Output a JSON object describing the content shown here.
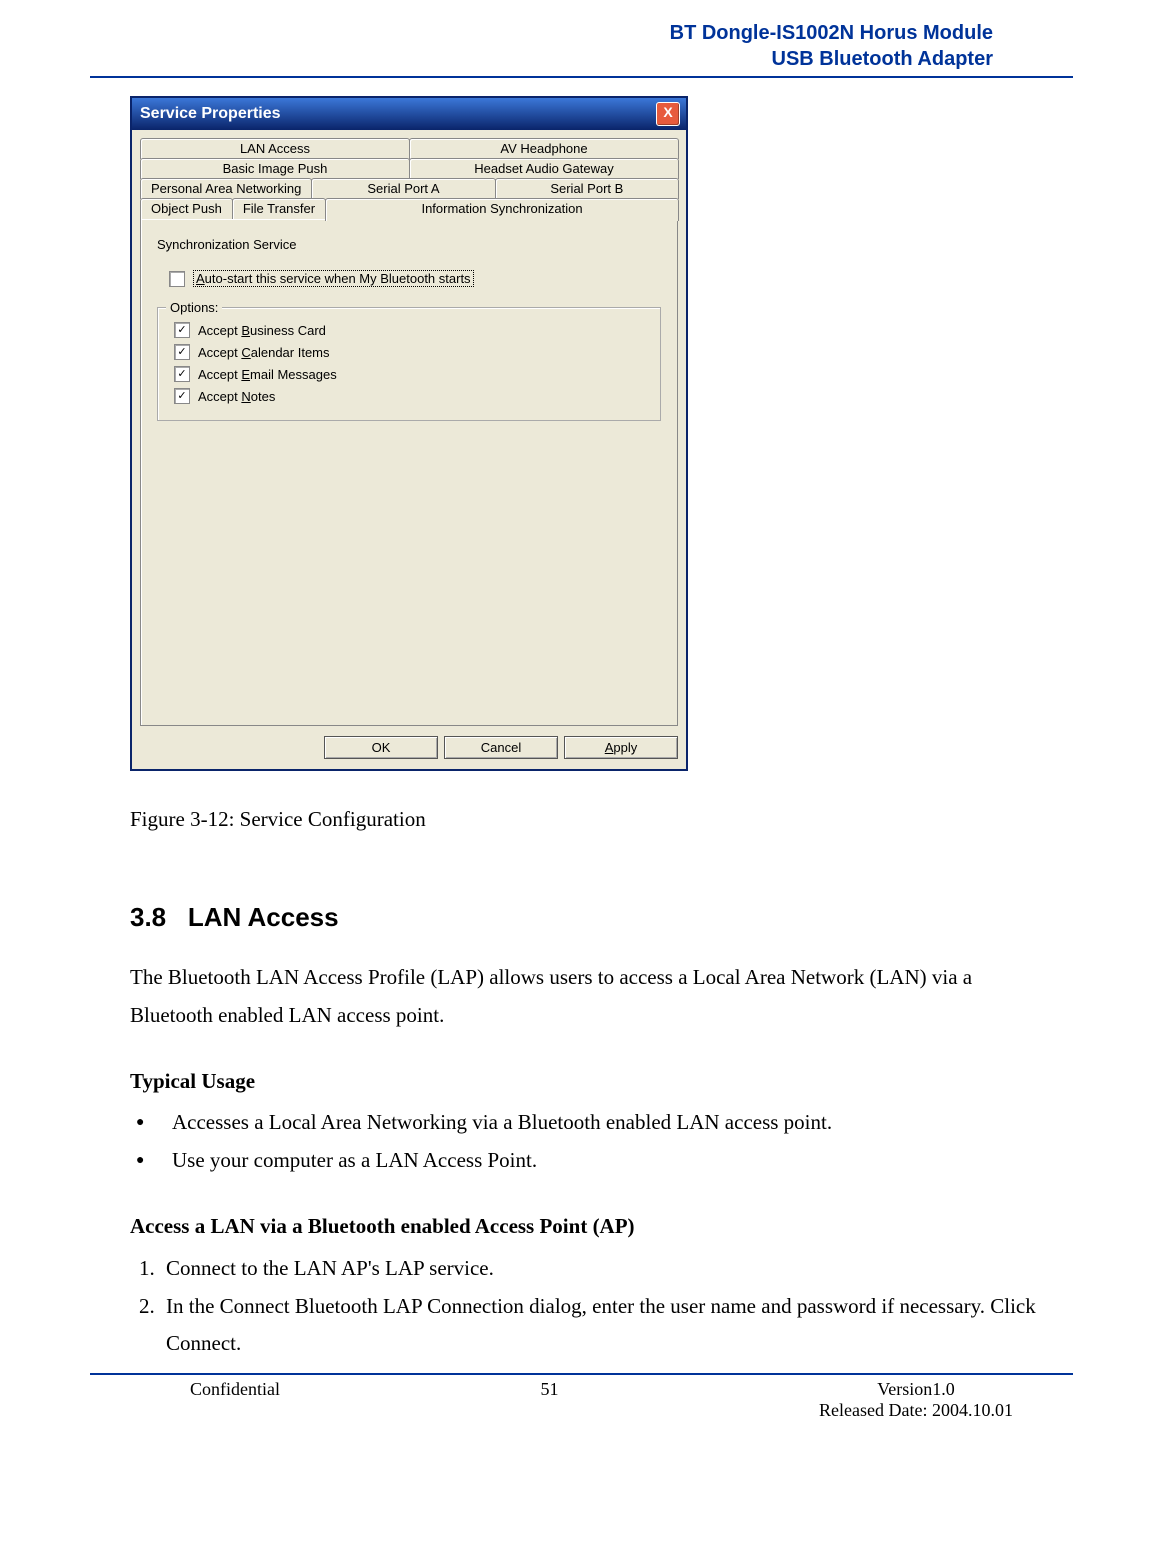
{
  "header": {
    "line1": "BT Dongle-IS1002N Horus Module",
    "line2": "USB Bluetooth Adapter"
  },
  "dialog": {
    "title": "Service Properties",
    "close_glyph": "X",
    "tabs_rows": [
      [
        "LAN Access",
        "AV Headphone"
      ],
      [
        "Basic Image Push",
        "Headset Audio Gateway"
      ],
      [
        "Personal Area Networking",
        "Serial Port A",
        "Serial Port B"
      ],
      [
        "Object Push",
        "File Transfer",
        "Information Synchronization"
      ]
    ],
    "active_tab": "Information Synchronization",
    "service_title": "Synchronization Service",
    "autostart_prefix": "A",
    "autostart_rest": "uto-start this service when My Bluetooth starts",
    "options_legend": "Options:",
    "options": [
      {
        "pre": "Accept ",
        "u": "B",
        "post": "usiness Card",
        "checked": true
      },
      {
        "pre": "Accept ",
        "u": "C",
        "post": "alendar Items",
        "checked": true
      },
      {
        "pre": "Accept ",
        "u": "E",
        "post": "mail Messages",
        "checked": true
      },
      {
        "pre": "Accept ",
        "u": "N",
        "post": "otes",
        "checked": true
      }
    ],
    "buttons": {
      "ok": "OK",
      "cancel": "Cancel",
      "apply_u": "A",
      "apply_rest": "pply"
    }
  },
  "caption": "Figure 3-12: Service Configuration",
  "section": {
    "num": "3.8",
    "title": "LAN Access",
    "intro": "The Bluetooth LAN Access Profile (LAP) allows users to access a Local Area Network (LAN) via a Bluetooth enabled LAN access point.",
    "typical_usage_h": "Typical Usage",
    "bullets": [
      "Accesses a Local Area Networking via a Bluetooth enabled LAN access point.",
      "Use your computer as a LAN Access Point."
    ],
    "access_h": "Access a LAN via a Bluetooth enabled Access Point (AP)",
    "steps": [
      "Connect to the LAN AP's LAP service.",
      "In the Connect Bluetooth LAP Connection dialog, enter the user name and password if necessary. Click Connect."
    ]
  },
  "footer": {
    "left": "Confidential",
    "center": "51",
    "right1": "Version1.0",
    "right2": "Released Date: 2004.10.01"
  }
}
